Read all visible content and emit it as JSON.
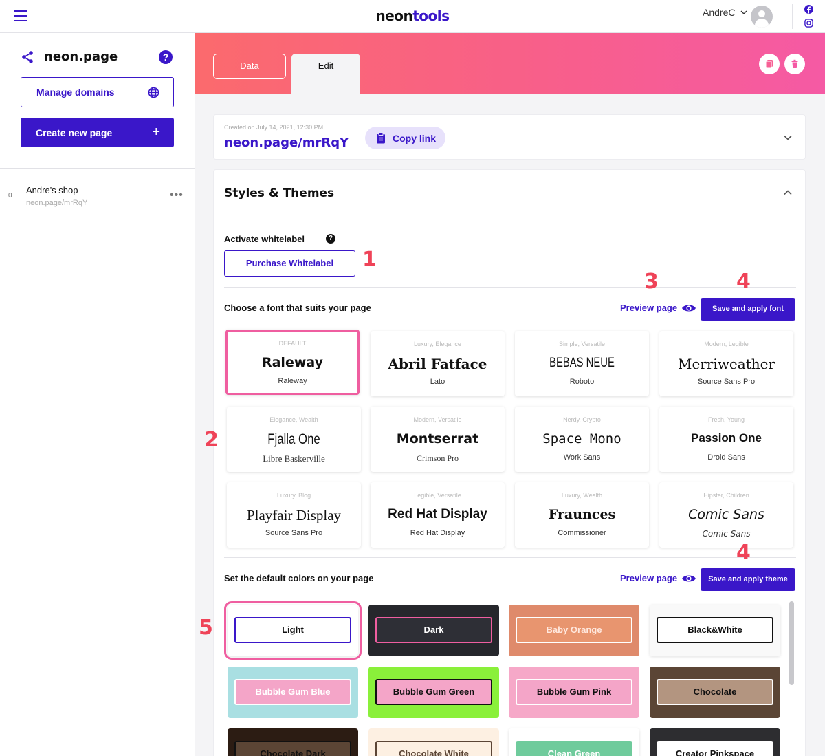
{
  "topbar": {
    "logo_part1": "neon",
    "logo_part2": "tools",
    "username": "AndreC"
  },
  "sidebar": {
    "site_name": "neon.page",
    "help_label": "?",
    "manage_domains_label": "Manage domains",
    "create_page_label": "Create new page",
    "create_page_icon": "+",
    "pages": [
      {
        "count": "0",
        "name": "Andre's shop",
        "url": "neon.page/mrRqY",
        "more": "•••"
      }
    ]
  },
  "header": {
    "tabs": [
      {
        "label": "Data"
      },
      {
        "label": "Edit"
      }
    ],
    "active_tab": "Edit"
  },
  "link_card": {
    "created": "Created on July 14, 2021, 12:30 PM",
    "url": "neon.page/mrRqY",
    "copy_label": "Copy link"
  },
  "styles": {
    "title": "Styles & Themes",
    "whitelabel_label": "Activate whitelabel",
    "whitelabel_help": "?",
    "purchase_label": "Purchase Whitelabel",
    "font_section_label": "Choose a font that suits your page",
    "preview_label": "Preview page",
    "save_font_label": "Save and apply font",
    "fonts": [
      {
        "tag": "DEFAULT",
        "name": "Raleway",
        "sub": "Raleway",
        "selected": true
      },
      {
        "tag": "Luxury, Elegance",
        "name": "Abril Fatface",
        "sub": "Lato"
      },
      {
        "tag": "Simple, Versatile",
        "name": "BEBAS NEUE",
        "sub": "Roboto"
      },
      {
        "tag": "Modern, Legible",
        "name": "Merriweather",
        "sub": "Source Sans Pro"
      },
      {
        "tag": "Elegance, Wealth",
        "name": "Fjalla One",
        "sub": "Libre Baskerville"
      },
      {
        "tag": "Modern, Versatile",
        "name": "Montserrat",
        "sub": "Crimson Pro"
      },
      {
        "tag": "Nerdy, Crypto",
        "name": "Space Mono",
        "sub": "Work Sans"
      },
      {
        "tag": "Fresh, Young",
        "name": "Passion One",
        "sub": "Droid Sans"
      },
      {
        "tag": "Luxury, Blog",
        "name": "Playfair Display",
        "sub": "Source Sans Pro"
      },
      {
        "tag": "Legible, Versatile",
        "name": "Red Hat Display",
        "sub": "Red Hat Display"
      },
      {
        "tag": "Luxury, Wealth",
        "name": "Fraunces",
        "sub": "Commissioner"
      },
      {
        "tag": "Hipster, Children",
        "name": "Comic Sans",
        "sub": "Comic Sans"
      }
    ],
    "color_section_label": "Set the default colors on your page",
    "save_theme_label": "Save and apply theme",
    "themes": [
      {
        "name": "Light",
        "bg": "#ffffff",
        "btn_bg": "#ffffff",
        "btn_border": "#3a17c9",
        "btn_text": "#111111",
        "selected": true
      },
      {
        "name": "Dark",
        "bg": "#26272c",
        "btn_bg": "#2e2f36",
        "btn_border": "#ef5ea0",
        "btn_text": "#ffffff"
      },
      {
        "name": "Baby Orange",
        "bg": "#df8a6b",
        "btn_bg": "#e8956f",
        "btn_border": "#ffffff",
        "btn_text": "#ffe8de"
      },
      {
        "name": "Black&White",
        "bg": "#f9f9f9",
        "btn_bg": "#ffffff",
        "btn_border": "#111111",
        "btn_text": "#111111"
      },
      {
        "name": "Bubble Gum Blue",
        "bg": "#a9dfe2",
        "btn_bg": "#f4a5c8",
        "btn_border": "#ffffff",
        "btn_text": "#ffffff"
      },
      {
        "name": "Bubble Gum Green",
        "bg": "#8af03a",
        "btn_bg": "#f4a5c8",
        "btn_border": "#111111",
        "btn_text": "#111111"
      },
      {
        "name": "Bubble Gum Pink",
        "bg": "#f6a8c8",
        "btn_bg": "#f4a5c8",
        "btn_border": "#ffffff",
        "btn_text": "#111111"
      },
      {
        "name": "Chocolate",
        "bg": "#5b4535",
        "btn_bg": "#b39580",
        "btn_border": "#ffffff",
        "btn_text": "#111111"
      },
      {
        "name": "Chocolate Dark",
        "bg": "#2c1c13",
        "btn_bg": "#5b4535",
        "btn_border": "#111111",
        "btn_text": "#111111"
      },
      {
        "name": "Chocolate White",
        "bg": "#fdf0e2",
        "btn_bg": "#fdf0e2",
        "btn_border": "#5b4535",
        "btn_text": "#5b4535"
      },
      {
        "name": "Clean Green",
        "bg": "#ffffff",
        "btn_bg": "#6fcb9c",
        "btn_border": "#6fcb9c",
        "btn_text": "#ffffff"
      },
      {
        "name": "Creator Pinkspace",
        "bg": "#2d2d30",
        "btn_bg": "#ffffff",
        "btn_border": "#ffffff",
        "btn_text": "#111111"
      }
    ]
  },
  "annotations": {
    "a1": "1",
    "a2": "2",
    "a3": "3",
    "a4a": "4",
    "a4b": "4",
    "a5": "5"
  },
  "colors": {
    "accent": "#3a17c9",
    "highlight": "#ef5ea0",
    "annotation": "#ef4358"
  }
}
